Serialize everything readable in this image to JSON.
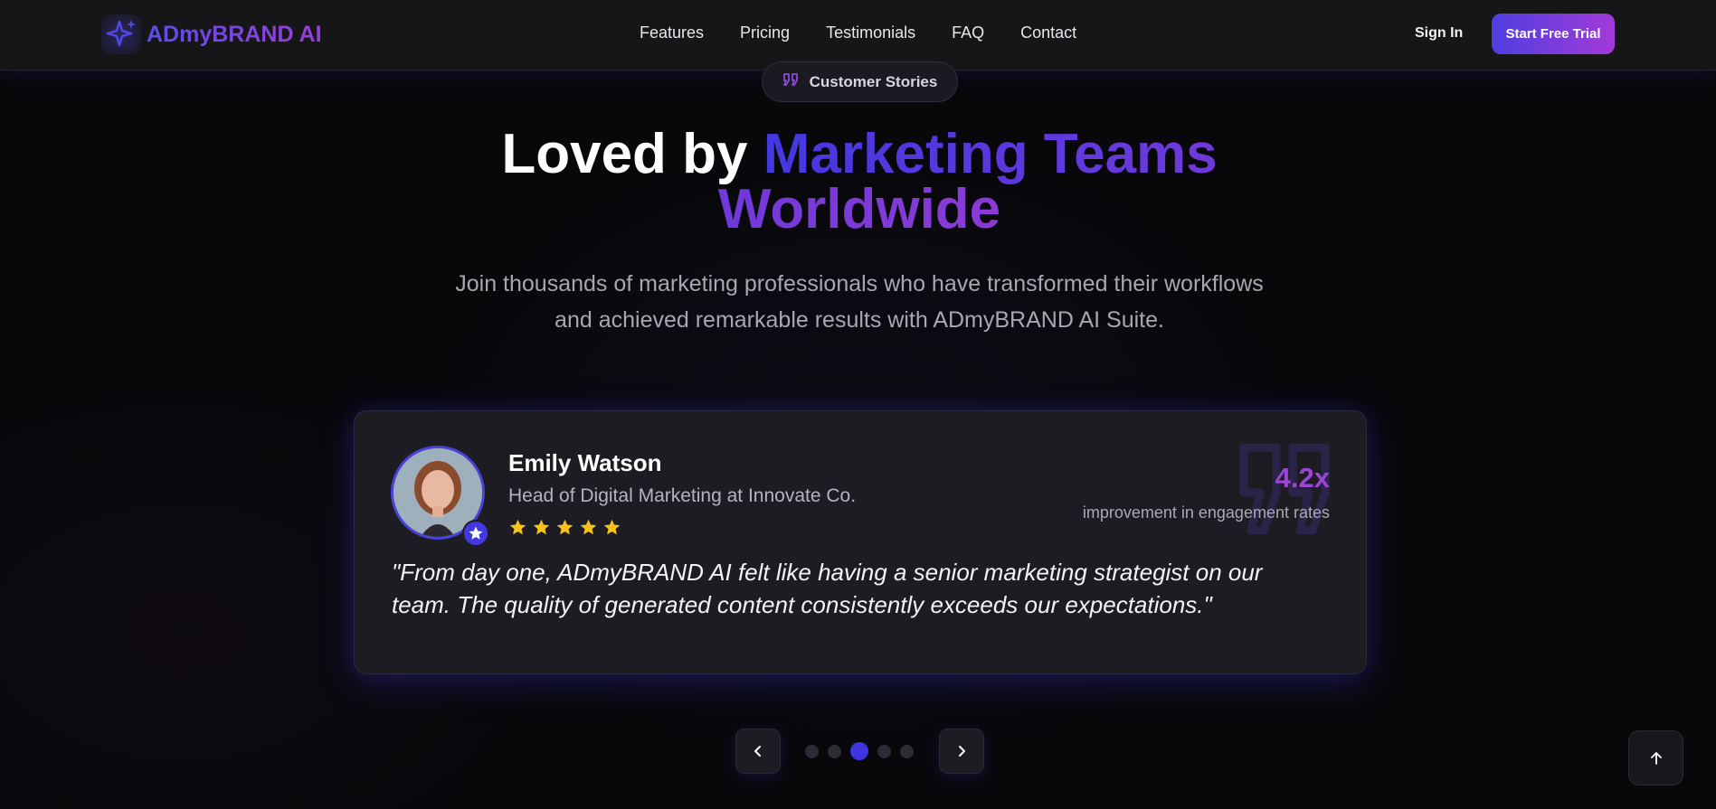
{
  "brand": {
    "name": "ADmyBRAND AI",
    "icon": "sparkles-icon"
  },
  "nav": {
    "links": [
      "Features",
      "Pricing",
      "Testimonials",
      "FAQ",
      "Contact"
    ],
    "sign_in": "Sign In",
    "cta": "Start Free Trial"
  },
  "section": {
    "badge": "Customer Stories",
    "badge_icon": "quote-icon",
    "title_plain": "Loved by",
    "title_gradient": "Marketing Teams Worldwide",
    "subtitle": "Join thousands of marketing professionals who have transformed their workflows and achieved remarkable results with ADmyBRAND AI Suite."
  },
  "testimonial": {
    "name": "Emily Watson",
    "role": "Head of Digital Marketing at Innovate Co.",
    "rating": 5,
    "metric_value": "4.2x",
    "metric_label": "improvement in engagement rates",
    "quote": "\"From day one, ADmyBRAND AI felt like having a senior marketing strategist on our team. The quality of generated content consistently exceeds our expectations.\""
  },
  "carousel": {
    "total": 5,
    "active_index": 2
  },
  "colors": {
    "accent": "#4f3fe0",
    "accent_end": "#a23ad8",
    "star": "#f6c21b",
    "background": "#08080b"
  }
}
